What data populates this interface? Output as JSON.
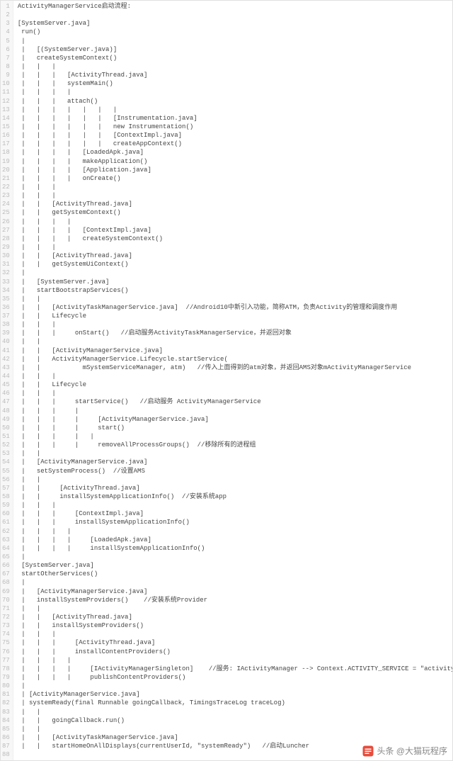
{
  "title": "ActivityManagerService启动流程:",
  "watermark": "头条 @大猫玩程序",
  "lines": [
    "ActivityManagerService启动流程:",
    "",
    "[SystemServer.java]",
    " run()",
    " |",
    " |   [(SystemServer.java)]",
    " |   createSystemContext()",
    " |   |   |",
    " |   |   |   [ActivityThread.java]",
    " |   |   |   systemMain()",
    " |   |   |   |",
    " |   |   |   attach()",
    " |   |   |   |   |   |   |",
    " |   |   |   |   |   |   [Instrumentation.java]",
    " |   |   |   |   |   |   new Instrumentation()",
    " |   |   |   |   |   |   [ContextImpl.java]",
    " |   |   |   |   |   |   createAppContext()",
    " |   |   |   |   [LoadedApk.java]",
    " |   |   |   |   makeApplication()",
    " |   |   |   |   [Application.java]",
    " |   |   |   |   onCreate()",
    " |   |   |",
    " |   |   |",
    " |   |   [ActivityThread.java]",
    " |   |   getSystemContext()",
    " |   |   |   |",
    " |   |   |   |   [ContextImpl.java]",
    " |   |   |   |   createSystemContext()",
    " |   |   |",
    " |   |   [ActivityThread.java]",
    " |   |   getSystemUiContext()",
    " |",
    " |   [SystemServer.java]",
    " |   startBootstrapServices()",
    " |   |",
    " |   |   [ActivityTaskManagerService.java]  //Android10中新引入功能，简称ATM，负责Activity的管理和调度作用",
    " |   |   Lifecycle",
    " |   |   |",
    " |   |   |     onStart()   //启动服务ActivityTaskManagerService，并返回对象",
    " |   |",
    " |   |   [ActivityManagerService.java]",
    " |   |   ActivityManagerService.Lifecycle.startService(",
    " |   |           mSystemServiceManager, atm)   //传入上面得到的atm对象，并返回AMS对象mActivityManagerService",
    " |   |   |",
    " |   |   Lifecycle",
    " |   |   |",
    " |   |   |     startService()   //启动服务 ActivityManagerService",
    " |   |   |     |",
    " |   |   |     |     [ActivityManagerService.java]",
    " |   |   |     |     start()",
    " |   |   |     |   |",
    " |   |   |     |     removeAllProcessGroups()  //移除所有的进程组",
    " |   |",
    " |   [ActivityManagerService.java]",
    " |   setSystemProcess()  //设置AMS",
    " |   |",
    " |   |     [ActivityThread.java]",
    " |   |     installSystemApplicationInfo()  //安装系统app",
    " |   |   |",
    " |   |   |     [ContextImpl.java]",
    " |   |   |     installSystemApplicationInfo()",
    " |   |   |   |",
    " |   |   |   |     [LoadedApk.java]",
    " |   |   |   |     installSystemApplicationInfo()",
    " |",
    " [SystemServer.java]",
    " startOtherServices()",
    " |",
    " |   [ActivityManagerService.java]",
    " |   installSystemProviders()    //安装系统Provider",
    " |   |",
    " |   |   [ActivityThread.java]",
    " |   |   installSystemProviders()",
    " |   |   |",
    " |   |   |     [ActivityThread.java]",
    " |   |   |     installContentProviders()",
    " |   |   |   |",
    " |   |   |   |     [IActivityManagerSingleton]    //服务: IActivityManager --> Context.ACTIVITY_SERVICE = \"activity\"",
    " |   |   |   |     publishContentProviders()",
    " |",
    " | [ActivityManagerService.java]",
    " | systemReady(final Runnable goingCallback, TimingsTraceLog traceLog)",
    " |   |",
    " |   |   goingCallback.run()",
    " |   |",
    " |   |   [ActivityTaskManagerService.java]",
    " |   |   startHomeOnAllDisplays(currentUserId, \"systemReady\")   //启动Luncher",
    ""
  ]
}
